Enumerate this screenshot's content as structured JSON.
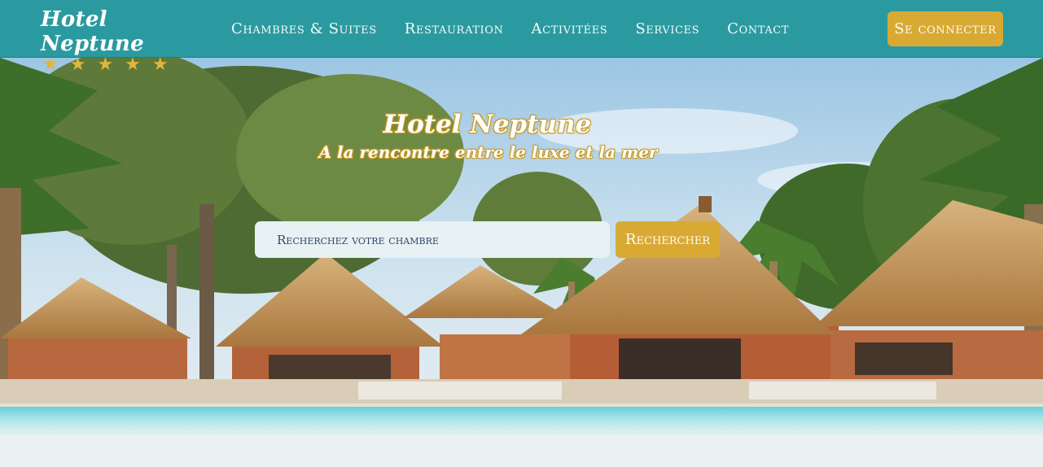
{
  "header": {
    "brand_name": "Hotel Neptune",
    "brand_stars": "★★★★★",
    "nav": [
      {
        "label": "Chambres & Suites"
      },
      {
        "label": "Restauration"
      },
      {
        "label": "Activitées"
      },
      {
        "label": "Services"
      },
      {
        "label": "Contact"
      }
    ],
    "login_label": "Se connecter"
  },
  "hero": {
    "title": "Hotel Neptune",
    "subtitle": "A la rencontre entre le luxe et la mer",
    "image": "resort-pool-thatched-huts-palms",
    "search": {
      "placeholder": "Recherchez votre chambre",
      "button_label": "Rechercher"
    }
  },
  "colors": {
    "nav_bg": "#2b9aa0",
    "accent_gold": "#d8aa34",
    "page_bg": "#e9f1f1",
    "search_bg": "#e8f1f3"
  },
  "icons": [
    "star-icon"
  ]
}
